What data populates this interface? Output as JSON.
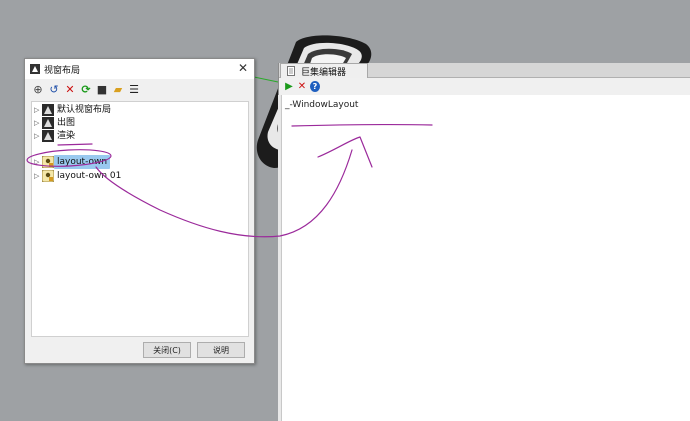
{
  "dialog": {
    "title": "视窗布局",
    "close_glyph": "✕",
    "toolbar": [
      {
        "name": "new-layout-icon",
        "glyph": "⊕"
      },
      {
        "name": "restore-icon",
        "glyph": "↺"
      },
      {
        "name": "delete-icon",
        "glyph": "✕"
      },
      {
        "name": "refresh-icon",
        "glyph": "⟳"
      },
      {
        "name": "save-icon",
        "glyph": "■"
      },
      {
        "name": "open-folder-icon",
        "glyph": "▰"
      },
      {
        "name": "menu-icon",
        "glyph": "☰"
      }
    ],
    "tree_items": [
      {
        "label": "默认视窗布局"
      },
      {
        "label": "出图"
      },
      {
        "label": "渲染"
      },
      {
        "label": "layout-own",
        "selected": true
      },
      {
        "label": "layout-own 01"
      }
    ],
    "close_button_label": "关闭(C)",
    "help_button_label": "说明"
  },
  "editor": {
    "tab_label": "巨集编辑器",
    "toolbar": [
      {
        "name": "run-icon",
        "glyph": "▶",
        "color": "#1a9a1a"
      },
      {
        "name": "stop-icon",
        "glyph": "✕",
        "color": "#cc1111"
      },
      {
        "name": "help-icon",
        "glyph": "?",
        "color": "#1f5fbf"
      }
    ],
    "content": "_-WindowLayout"
  },
  "colors": {
    "annotation": "#9b2a9b",
    "selection": "#99c9ef",
    "viewport_bg": "#9ea1a4"
  }
}
